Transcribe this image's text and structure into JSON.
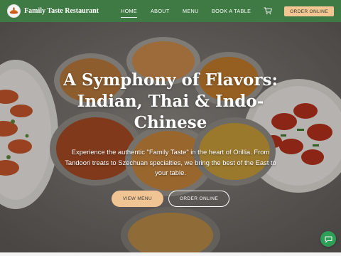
{
  "header": {
    "brand": "Family Taste Restaurant",
    "nav": [
      {
        "label": "HOME",
        "active": true
      },
      {
        "label": "ABOUT",
        "active": false
      },
      {
        "label": "MENU",
        "active": false
      },
      {
        "label": "BOOK A TABLE",
        "active": false
      }
    ],
    "cart_icon": "cart-icon",
    "order_label": "ORDER ONLINE"
  },
  "hero": {
    "title": "A Symphony of Flavors: Indian, Thai & Indo-Chinese",
    "subtitle": "Experience the authentic \"Family Taste\" in the heart of Orillia. From Tandoori treats to Szechuan specialties, we bring the best of the East to your table.",
    "view_menu_label": "VIEW MENU",
    "order_online_label": "ORDER ONLINE"
  },
  "chat": {
    "icon": "chat-icon"
  },
  "colors": {
    "header_bg": "#3f7a45",
    "accent": "#f1c494",
    "chat_bg": "#2f9e57"
  }
}
